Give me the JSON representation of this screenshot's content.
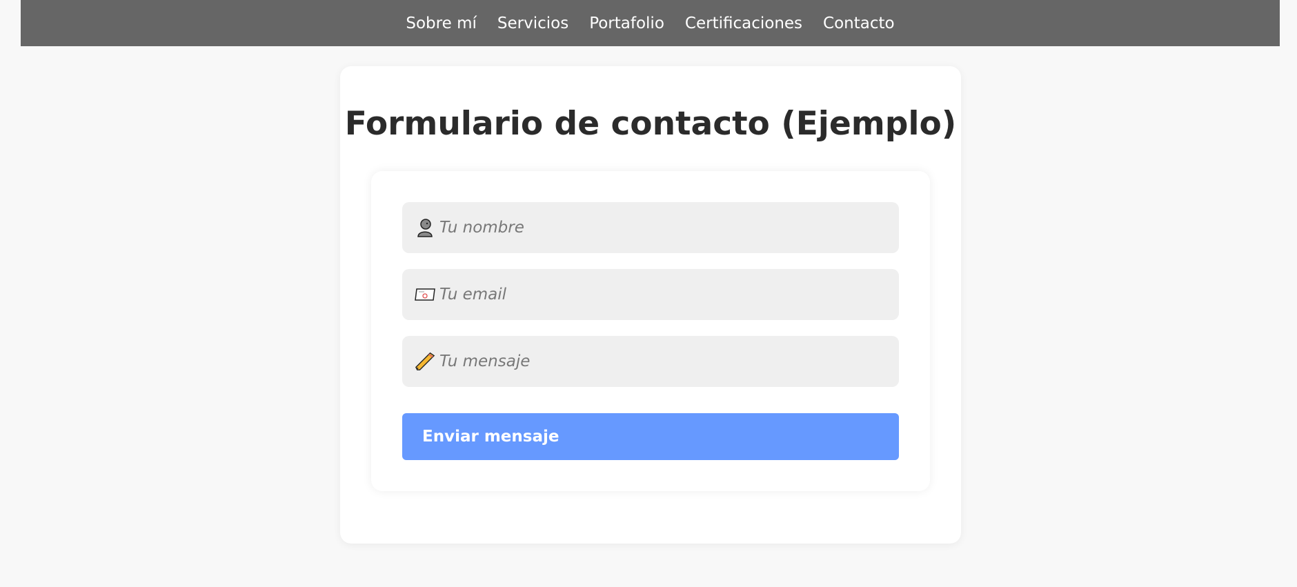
{
  "nav": {
    "items": [
      {
        "label": "Sobre mí"
      },
      {
        "label": "Servicios"
      },
      {
        "label": "Portafolio"
      },
      {
        "label": "Certificaciones"
      },
      {
        "label": "Contacto"
      }
    ]
  },
  "main": {
    "title": "Formulario de contacto (Ejemplo)"
  },
  "form": {
    "name_placeholder": "Tu nombre",
    "email_placeholder": "Tu email",
    "message_placeholder": "Tu mensaje",
    "name_icon": "person-icon",
    "email_icon": "envelope-icon",
    "message_icon": "pencil-icon",
    "submit_label": "Enviar mensaje"
  },
  "colors": {
    "navbar": "#666666",
    "button": "#6699ff",
    "field_bg": "#efefef"
  }
}
